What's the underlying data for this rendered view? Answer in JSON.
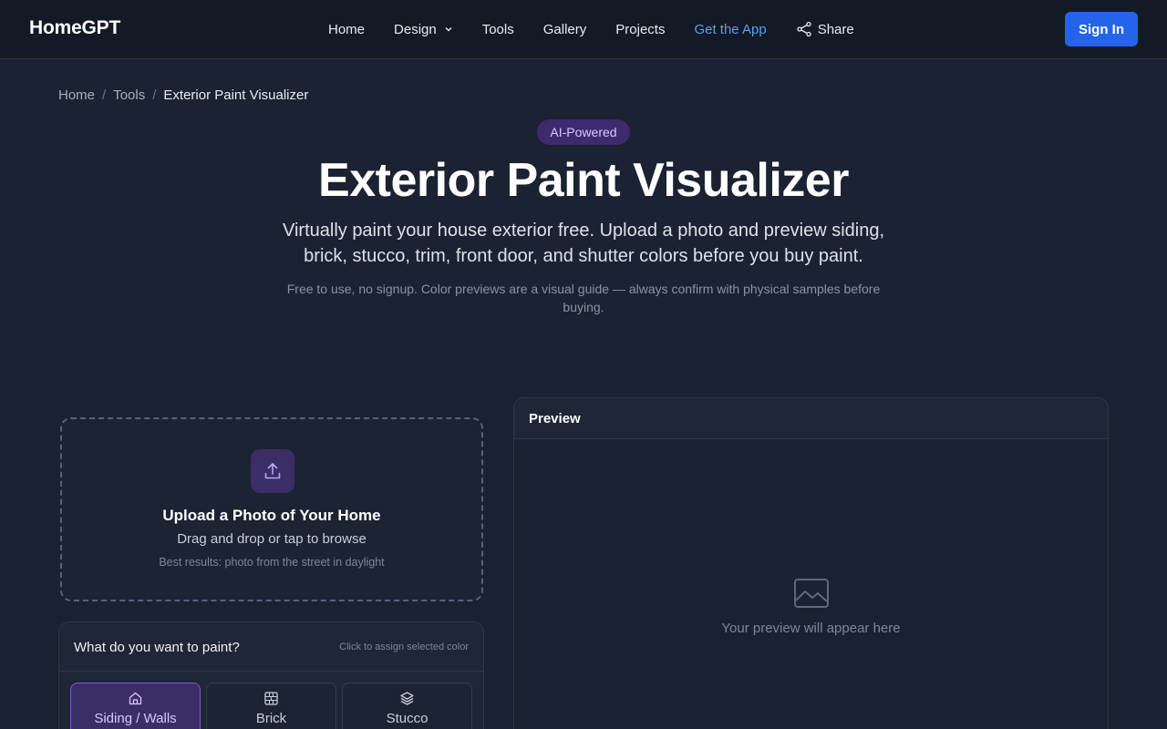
{
  "nav": {
    "brand": "HomeGPT",
    "links": [
      "Home",
      "Design",
      "Tools",
      "Gallery",
      "Projects",
      "Get the App",
      "Share"
    ],
    "sign_in": "Sign In"
  },
  "breadcrumb": {
    "items": [
      "Home",
      "Tools",
      "Exterior Paint Visualizer"
    ],
    "sep": "/"
  },
  "hero": {
    "badge": "AI-Powered",
    "title": "Exterior Paint Visualizer",
    "subtitle": "Virtually paint your house exterior free. Upload a photo and preview siding, brick, stucco, trim, front door, and shutter colors before you buy paint.",
    "note": "Free to use, no signup. Color previews are a visual guide — always confirm with physical samples before buying."
  },
  "upload": {
    "title": "Upload a Photo of Your Home",
    "subtitle": "Drag and drop or tap to browse",
    "hint": "Best results: photo from the street in daylight",
    "icon": "upload-icon"
  },
  "paint": {
    "question": "What do you want to paint?",
    "hint": "Click to assign selected color",
    "surfaces": [
      {
        "label": "Siding / Walls",
        "icon": "house-icon",
        "active": true
      },
      {
        "label": "Brick",
        "icon": "brick-icon",
        "active": false
      },
      {
        "label": "Stucco",
        "icon": "layers-icon",
        "active": false
      }
    ]
  },
  "preview": {
    "title": "Preview",
    "placeholder": "Your preview will appear here",
    "icon": "image-icon"
  },
  "colors": {
    "accent": "#2563eb",
    "link": "#5b9cf6",
    "purple": "#3b2d66"
  }
}
